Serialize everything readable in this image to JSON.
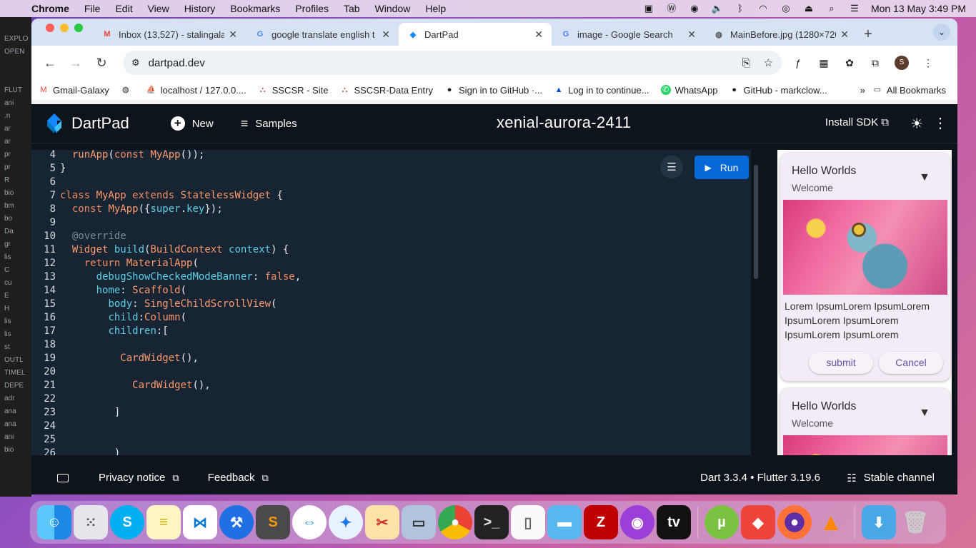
{
  "menubar": {
    "app": "Chrome",
    "items": [
      "File",
      "Edit",
      "View",
      "History",
      "Bookmarks",
      "Profiles",
      "Tab",
      "Window",
      "Help"
    ],
    "datetime": "Mon 13 May  3:49 PM"
  },
  "vscode_strip": [
    "EXPLO",
    "OPEN",
    "FLUT",
    "ani",
    ".n",
    "ar",
    "ar",
    "pr",
    "pr",
    "R",
    "bio",
    "bm",
    "bo",
    "Da",
    "gr",
    "lis",
    "C",
    "cu",
    "E",
    "H",
    "lis",
    "lis",
    "st",
    "OUTL",
    "TIMEL",
    "DEPE",
    "adr",
    "ana",
    "ana",
    "ani",
    "bio"
  ],
  "tabs": [
    {
      "title": "Inbox (13,527) - stalingala",
      "icon": "gmail-icon"
    },
    {
      "title": "google translate english t",
      "icon": "google-icon"
    },
    {
      "title": "DartPad",
      "icon": "dart-icon",
      "active": true
    },
    {
      "title": "image - Google Search",
      "icon": "google-icon"
    },
    {
      "title": "MainBefore.jpg (1280×720",
      "icon": "globe-icon"
    }
  ],
  "omnibox": {
    "url": "dartpad.dev"
  },
  "profile_initial": "S",
  "bookmarks": [
    {
      "label": "Gmail-Galaxy",
      "icon": "gmail-icon"
    },
    {
      "label": "",
      "icon": "globe-icon"
    },
    {
      "label": "localhost / 127.0.0....",
      "icon": "pma-icon"
    },
    {
      "label": "SSCSR - Site",
      "icon": "emblem-icon"
    },
    {
      "label": "SSCSR-Data Entry",
      "icon": "emblem-icon"
    },
    {
      "label": "Sign in to GitHub ·...",
      "icon": "github-icon"
    },
    {
      "label": "Log in to continue...",
      "icon": "atlassian-icon"
    },
    {
      "label": "WhatsApp",
      "icon": "whatsapp-icon"
    },
    {
      "label": "GitHub - markclow...",
      "icon": "github-icon"
    }
  ],
  "bookmarks_more": "»",
  "all_bookmarks": "All Bookmarks",
  "dartpad": {
    "title": "DartPad",
    "new_label": "New",
    "samples_label": "Samples",
    "project_name": "xenial-aurora-2411",
    "install_sdk": "Install SDK",
    "run_label": "Run",
    "line_numbers": [
      "4",
      "5",
      "6",
      "7",
      "8",
      "9",
      "10",
      "11",
      "12",
      "13",
      "14",
      "15",
      "16",
      "17",
      "18",
      "19",
      "20",
      "21",
      "22",
      "23",
      "24",
      "25",
      "26"
    ],
    "privacy": "Privacy notice",
    "feedback": "Feedback",
    "version": "Dart 3.3.4 • Flutter 3.19.6",
    "channel": "Stable channel"
  },
  "preview": {
    "cards": [
      {
        "title": "Hello Worlds",
        "subtitle": "Welcome",
        "body": "Lorem IpsumLorem IpsumLorem IpsumLorem IpsumLorem IpsumLorem IpsumLorem",
        "submit": "submit",
        "cancel": "Cancel"
      },
      {
        "title": "Hello Worlds",
        "subtitle": "Welcome"
      }
    ]
  },
  "dock": [
    "finder",
    "launchpad",
    "skype",
    "notes",
    "vscode",
    "xcode",
    "sublime",
    "teamviewer",
    "safari",
    "preview-tool",
    "image-capture",
    "chrome",
    "terminal",
    "textedit",
    "files",
    "filezilla",
    "podcasts",
    "appletv",
    "utorrent",
    "anydesk",
    "firefox",
    "vlc",
    "downloads",
    "trash"
  ]
}
